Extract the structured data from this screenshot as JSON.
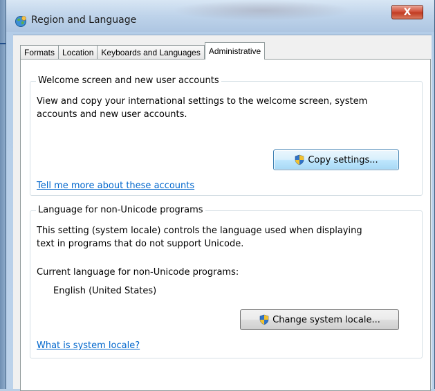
{
  "window": {
    "title": "Region and Language",
    "close_label": "X",
    "icon": "globe-icon"
  },
  "tabs": [
    {
      "label": "Formats",
      "active": false
    },
    {
      "label": "Location",
      "active": false
    },
    {
      "label": "Keyboards and Languages",
      "active": false
    },
    {
      "label": "Administrative",
      "active": true
    }
  ],
  "welcome_group": {
    "legend": "Welcome screen and new user accounts",
    "description_line1": "View and copy your international settings to the welcome screen, system",
    "description_line2": "accounts and new user accounts.",
    "button_label": "Copy settings...",
    "button_icon": "uac-shield-icon",
    "link": "Tell me more about these accounts"
  },
  "locale_group": {
    "legend": "Language for non-Unicode programs",
    "description_line1": "This setting (system locale) controls the language used when displaying",
    "description_line2": "text in programs that do not support Unicode.",
    "current_label": "Current language for non-Unicode programs:",
    "current_value": "English (United States)",
    "button_label": "Change system locale...",
    "button_icon": "uac-shield-icon",
    "link": "What is system locale?"
  },
  "colors": {
    "link": "#0066cc",
    "close_button": "#c13b22",
    "panel_border": "#919b9c"
  }
}
